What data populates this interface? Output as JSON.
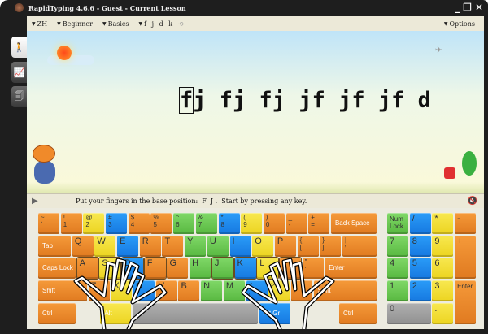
{
  "window": {
    "title": "RapidTyping 4.6.6 - Guest - Current Lesson",
    "minimize": "_",
    "restore": "❐",
    "close": "✕"
  },
  "toolbar": {
    "language": "ZH",
    "level": "Beginner",
    "course": "Basics",
    "lesson": "f j d k",
    "options": "Options"
  },
  "sidebar": [
    {
      "name": "lesson-mode",
      "icon": "walking-person-icon"
    },
    {
      "name": "statistics",
      "icon": "chart-icon"
    },
    {
      "name": "lesson-editor",
      "icon": "documents-icon"
    }
  ],
  "lesson": {
    "cursor_char": "f",
    "rest": "j fj fj jf jf jf d"
  },
  "status": {
    "message": "Put your fingers in the base position:  F  J .  Start by pressing any key."
  },
  "colors": {
    "orange": "#f08a2a",
    "yellow": "#f2e032",
    "blue": "#1e8ff0",
    "green": "#6cc850",
    "gray": "#a0a0a0"
  },
  "keyboard": {
    "rows": [
      [
        [
          "~",
          "`",
          "o"
        ],
        [
          "!",
          "1",
          "o"
        ],
        [
          "@",
          "2",
          "y"
        ],
        [
          "#",
          "3",
          "b"
        ],
        [
          "$",
          "4",
          "o"
        ],
        [
          "%",
          "5",
          "o"
        ],
        [
          "^",
          "6",
          "g"
        ],
        [
          "&",
          "7",
          "g"
        ],
        [
          "*",
          "8",
          "b"
        ],
        [
          "(",
          "9",
          "y"
        ],
        [
          ")",
          "0",
          "o"
        ],
        [
          "_",
          "-",
          "o"
        ],
        [
          "+",
          "=",
          "o"
        ],
        [
          "Back Space",
          "",
          "o",
          "wide"
        ]
      ],
      [
        [
          "Tab",
          "",
          "o",
          "tab"
        ],
        [
          "Q",
          "",
          "o"
        ],
        [
          "W",
          "",
          "y"
        ],
        [
          "E",
          "",
          "b"
        ],
        [
          "R",
          "",
          "o"
        ],
        [
          "T",
          "",
          "o"
        ],
        [
          "Y",
          "",
          "g"
        ],
        [
          "U",
          "",
          "g"
        ],
        [
          "I",
          "",
          "b"
        ],
        [
          "O",
          "",
          "y"
        ],
        [
          "P",
          "",
          "o"
        ],
        [
          "{",
          "[",
          "o"
        ],
        [
          "}",
          "]",
          "o"
        ],
        [
          "|",
          "\\",
          "o",
          "wide"
        ]
      ],
      [
        [
          "Caps Lock",
          "",
          "o",
          "caps"
        ],
        [
          "A",
          "",
          "o",
          "home"
        ],
        [
          "S",
          "",
          "y",
          "home"
        ],
        [
          "D",
          "",
          "b",
          "home"
        ],
        [
          "F",
          "",
          "o",
          "home"
        ],
        [
          "G",
          "",
          "o"
        ],
        [
          "H",
          "",
          "g"
        ],
        [
          "J",
          "",
          "g",
          "home"
        ],
        [
          "K",
          "",
          "b",
          "home"
        ],
        [
          "L",
          "",
          "y",
          "home"
        ],
        [
          ":",
          ";",
          "o",
          "home"
        ],
        [
          "\"",
          "'",
          "o"
        ],
        [
          "Enter",
          "",
          "o",
          "wide"
        ]
      ],
      [
        [
          "Shift",
          "",
          "o",
          "shift"
        ],
        [
          "Z",
          "",
          "o"
        ],
        [
          "X",
          "",
          "y"
        ],
        [
          "C",
          "",
          "b"
        ],
        [
          "V",
          "",
          "o"
        ],
        [
          "B",
          "",
          "o"
        ],
        [
          "N",
          "",
          "g"
        ],
        [
          "M",
          "",
          "g"
        ],
        [
          "<",
          ",",
          "b"
        ],
        [
          ">",
          ".",
          "y"
        ],
        [
          "?",
          "/",
          "o"
        ],
        [
          "Shift",
          "",
          "o",
          "wide"
        ]
      ],
      [
        [
          "Ctrl",
          "",
          "o",
          "caps"
        ],
        [
          "",
          "",
          "sp",
          "gap"
        ],
        [
          "Alt",
          "",
          "y",
          "alt"
        ],
        [
          "",
          "",
          "s",
          "space"
        ],
        [
          "Alt Gr",
          "",
          "b",
          "alt"
        ],
        [
          "",
          "",
          "sp",
          "wide"
        ],
        [
          "Ctrl",
          "",
          "o",
          "caps"
        ]
      ]
    ],
    "numpad": [
      [
        "Num Lock",
        "g",
        0,
        0,
        1,
        1
      ],
      [
        "/",
        "b",
        1,
        0,
        1,
        1
      ],
      [
        "*",
        "y",
        2,
        0,
        1,
        1
      ],
      [
        "-",
        "o",
        3,
        0,
        1,
        1
      ],
      [
        "7",
        "g",
        0,
        1,
        1,
        1
      ],
      [
        "8",
        "b",
        1,
        1,
        1,
        1
      ],
      [
        "9",
        "y",
        2,
        1,
        1,
        1
      ],
      [
        "+",
        "o",
        3,
        1,
        1,
        2
      ],
      [
        "4",
        "g",
        0,
        2,
        1,
        1
      ],
      [
        "5",
        "b",
        1,
        2,
        1,
        1
      ],
      [
        "6",
        "y",
        2,
        2,
        1,
        1
      ],
      [
        "1",
        "g",
        0,
        3,
        1,
        1
      ],
      [
        "2",
        "b",
        1,
        3,
        1,
        1
      ],
      [
        "3",
        "y",
        2,
        3,
        1,
        1
      ],
      [
        "Enter",
        "o",
        3,
        3,
        1,
        2
      ],
      [
        "0",
        "s",
        0,
        4,
        2,
        1
      ],
      [
        ".",
        "y",
        2,
        4,
        1,
        1
      ]
    ]
  }
}
